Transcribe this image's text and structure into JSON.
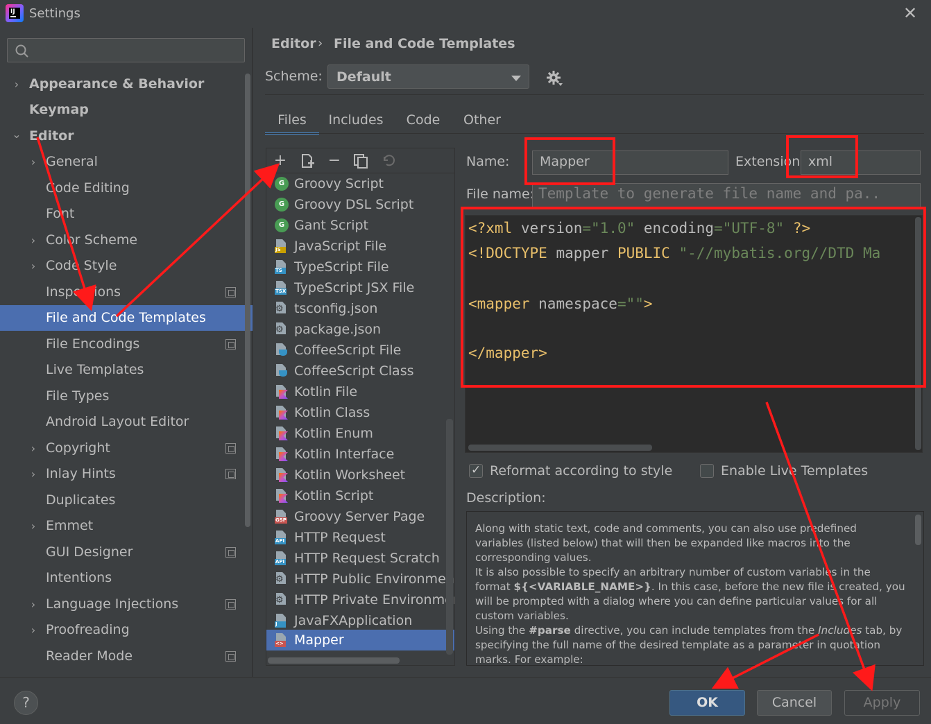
{
  "window": {
    "title": "Settings",
    "close": "✕"
  },
  "search": {
    "placeholder": ""
  },
  "sidebar": {
    "items": [
      {
        "label": "Appearance & Behavior",
        "chevron": "›"
      },
      {
        "label": "Keymap"
      },
      {
        "label": "Editor",
        "chevron": "⌄"
      },
      {
        "label": "General",
        "chevron": "›"
      },
      {
        "label": "Code Editing"
      },
      {
        "label": "Font"
      },
      {
        "label": "Color Scheme",
        "chevron": "›"
      },
      {
        "label": "Code Style",
        "chevron": "›"
      },
      {
        "label": "Inspections"
      },
      {
        "label": "File and Code Templates"
      },
      {
        "label": "File Encodings"
      },
      {
        "label": "Live Templates"
      },
      {
        "label": "File Types"
      },
      {
        "label": "Android Layout Editor"
      },
      {
        "label": "Copyright",
        "chevron": "›"
      },
      {
        "label": "Inlay Hints",
        "chevron": "›"
      },
      {
        "label": "Duplicates"
      },
      {
        "label": "Emmet",
        "chevron": "›"
      },
      {
        "label": "GUI Designer"
      },
      {
        "label": "Intentions"
      },
      {
        "label": "Language Injections",
        "chevron": "›"
      },
      {
        "label": "Proofreading",
        "chevron": "›"
      },
      {
        "label": "Reader Mode"
      }
    ]
  },
  "breadcrumb": {
    "root": "Editor",
    "separator": "›",
    "leaf": "File and Code Templates"
  },
  "scheme": {
    "label": "Scheme:",
    "value": "Default"
  },
  "tabs": [
    "Files",
    "Includes",
    "Code",
    "Other"
  ],
  "templates": [
    {
      "name": "Groovy Script",
      "icon": "groovy-icon",
      "badge": "G"
    },
    {
      "name": "Groovy DSL Script",
      "icon": "groovy-icon",
      "badge": "G"
    },
    {
      "name": "Gant Script",
      "icon": "groovy-icon",
      "badge": "G"
    },
    {
      "name": "JavaScript File",
      "icon": "javascript-file-icon",
      "badge": "JS"
    },
    {
      "name": "TypeScript File",
      "icon": "typescript-file-icon",
      "badge": "TS"
    },
    {
      "name": "TypeScript JSX File",
      "icon": "tsx-file-icon",
      "badge": "TSX"
    },
    {
      "name": "tsconfig.json",
      "icon": "config-file-icon"
    },
    {
      "name": "package.json",
      "icon": "config-file-icon"
    },
    {
      "name": "CoffeeScript File",
      "icon": "coffeescript-icon"
    },
    {
      "name": "CoffeeScript Class",
      "icon": "coffeescript-icon"
    },
    {
      "name": "Kotlin File",
      "icon": "kotlin-icon"
    },
    {
      "name": "Kotlin Class",
      "icon": "kotlin-icon"
    },
    {
      "name": "Kotlin Enum",
      "icon": "kotlin-icon"
    },
    {
      "name": "Kotlin Interface",
      "icon": "kotlin-icon"
    },
    {
      "name": "Kotlin Worksheet",
      "icon": "kotlin-icon"
    },
    {
      "name": "Kotlin Script",
      "icon": "kotlin-icon"
    },
    {
      "name": "Groovy Server Page",
      "icon": "gsp-file-icon",
      "badge": "GSP"
    },
    {
      "name": "HTTP Request",
      "icon": "http-request-icon",
      "badge": "API"
    },
    {
      "name": "HTTP Request Scratch",
      "icon": "http-request-icon",
      "badge": "API"
    },
    {
      "name": "HTTP Public Environment F",
      "icon": "config-file-icon"
    },
    {
      "name": "HTTP Private Environment I",
      "icon": "config-file-icon"
    },
    {
      "name": "JavaFXApplication",
      "icon": "java-file-icon",
      "badge": "J"
    },
    {
      "name": "Mapper",
      "icon": "xml-file-icon",
      "badge": "<>"
    }
  ],
  "form": {
    "name_label": "Name:",
    "name_value": "Mapper",
    "extension_label": "Extension:",
    "extension_value": "xml",
    "filename_label": "File name:",
    "filename_placeholder": "Template to generate file name and pa..",
    "reformat_label": "Reformat according to style",
    "reformat_checked": true,
    "live_templates_label": "Enable Live Templates",
    "live_templates_checked": false,
    "description_label": "Description:"
  },
  "code": {
    "line1": {
      "open": "<?xml ",
      "a1": "version",
      "eq1": "=",
      "v1": "\"1.0\"",
      "a2": " encoding",
      "eq2": "=",
      "v2": "\"UTF-8\"",
      "close": " ?>"
    },
    "line2": {
      "open": "<!DOCTYPE ",
      "a1": "mapper ",
      "a2": "PUBLIC ",
      "v1": "\"-//mybatis.org//DTD Ma"
    },
    "line3": {
      "open": "<mapper ",
      "a1": "namespace",
      "eq1": "=",
      "v1": "\"\"",
      "close": ">"
    },
    "line4": {
      "tag": "</mapper>"
    }
  },
  "description": {
    "p1": "Along with static text, code and comments, you can also use predefined variables (listed below) that will then be expanded like macros into the corresponding values.",
    "p2a": "It is also possible to specify an arbitrary number of custom variables in the format ",
    "p2b": "${<VARIABLE_NAME>}",
    "p2c": ". In this case, before the new file is created, you will be prompted with a dialog where you can define particular values for all custom variables.",
    "p3a": "Using the ",
    "p3b": "#parse",
    "p3c": " directive, you can include templates from the ",
    "p3d": "Includes",
    "p3e": " tab, by specifying the full name of the desired template as a parameter in quotation marks. For example:"
  },
  "buttons": {
    "help": "?",
    "ok": "OK",
    "cancel": "Cancel",
    "apply": "Apply"
  },
  "colors": {
    "annotation": "#ff1a1a",
    "selection": "#4b6eaf",
    "accent": "#4a88c7"
  }
}
